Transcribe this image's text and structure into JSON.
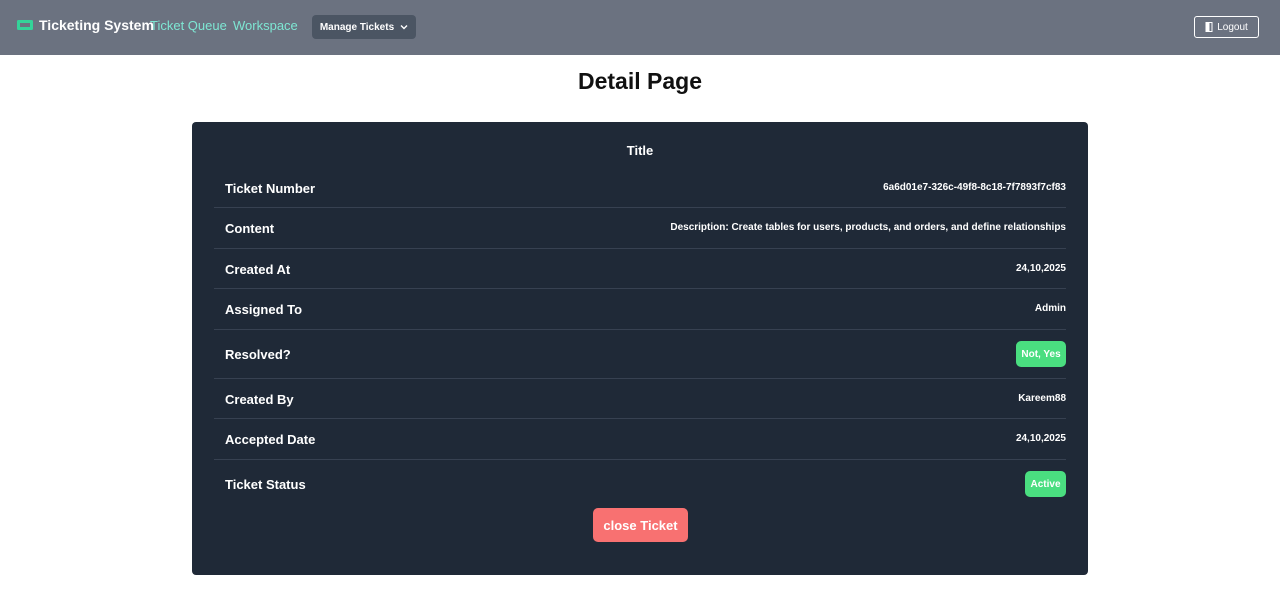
{
  "navbar": {
    "brand": "Ticketing System",
    "brand_icon": "ticket-icon",
    "links": [
      "Ticket Queue",
      "Workspace"
    ],
    "manage_label": "Manage Tickets",
    "logout_label": "Logout",
    "colors": {
      "bar": "#6b7280",
      "link": "#7ee7d3",
      "dropdown": "#4b5563"
    }
  },
  "page": {
    "title": "Detail Page"
  },
  "card": {
    "title": "Title",
    "rows": [
      {
        "label": "Ticket Number",
        "value": "6a6d01e7-326c-49f8-8c18-7f7893f7cf83"
      },
      {
        "label": "Content",
        "value": "Description: Create tables for users, products, and orders, and define relationships"
      },
      {
        "label": "Created At",
        "value": "24,10,2025"
      },
      {
        "label": "Assigned To",
        "value": "Admin"
      },
      {
        "label": "Resolved?",
        "value": "Not, Yes"
      },
      {
        "label": "Created By",
        "value": "Kareem88"
      },
      {
        "label": "Accepted Date",
        "value": "24,10,2025"
      },
      {
        "label": "Ticket Status",
        "value": "Active"
      }
    ],
    "close_label": "close Ticket",
    "colors": {
      "background": "#1f2937",
      "badge": "#4ade80",
      "close": "#f87171"
    }
  }
}
